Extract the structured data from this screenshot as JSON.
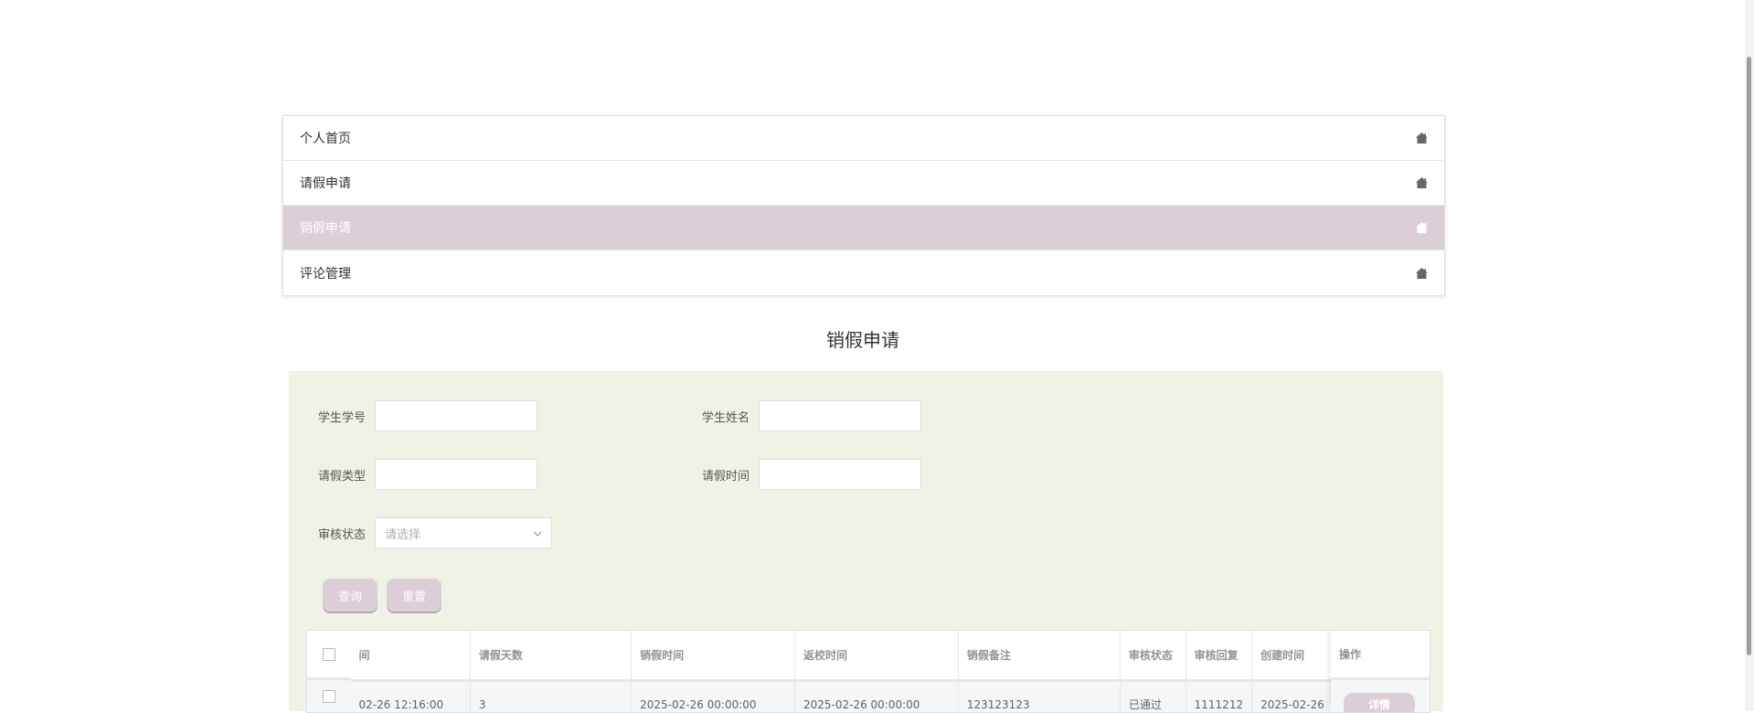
{
  "nav": {
    "items": [
      {
        "label": "个人首页",
        "active": false
      },
      {
        "label": "请假申请",
        "active": false
      },
      {
        "label": "销假申请",
        "active": true
      },
      {
        "label": "评论管理",
        "active": false
      }
    ],
    "icon": "home-icon",
    "active_color": "#dbced6"
  },
  "page_title": "销假申请",
  "search": {
    "student_no_label": "学生学号",
    "student_name_label": "学生姓名",
    "leave_type_label": "请假类型",
    "leave_time_label": "请假时间",
    "review_status_label": "审核状态",
    "review_status_placeholder": "请选择",
    "query_button": "查询",
    "reset_button": "重置"
  },
  "table": {
    "columns": [
      "间",
      "请假天数",
      "销假时间",
      "返校时间",
      "销假备注",
      "审核状态",
      "审核回复",
      "创建时间"
    ],
    "action_header": "操作",
    "rows": [
      {
        "cells": [
          "02-26 12:16:00",
          "3",
          "2025-02-26 00:00:00",
          "2025-02-26 00:00:00",
          "123123123",
          "已通过",
          "1111212",
          "2025-02-26"
        ],
        "action": "详情"
      }
    ]
  },
  "colors": {
    "panel_bg": "#eff2e5",
    "accent": "#dbced6"
  }
}
